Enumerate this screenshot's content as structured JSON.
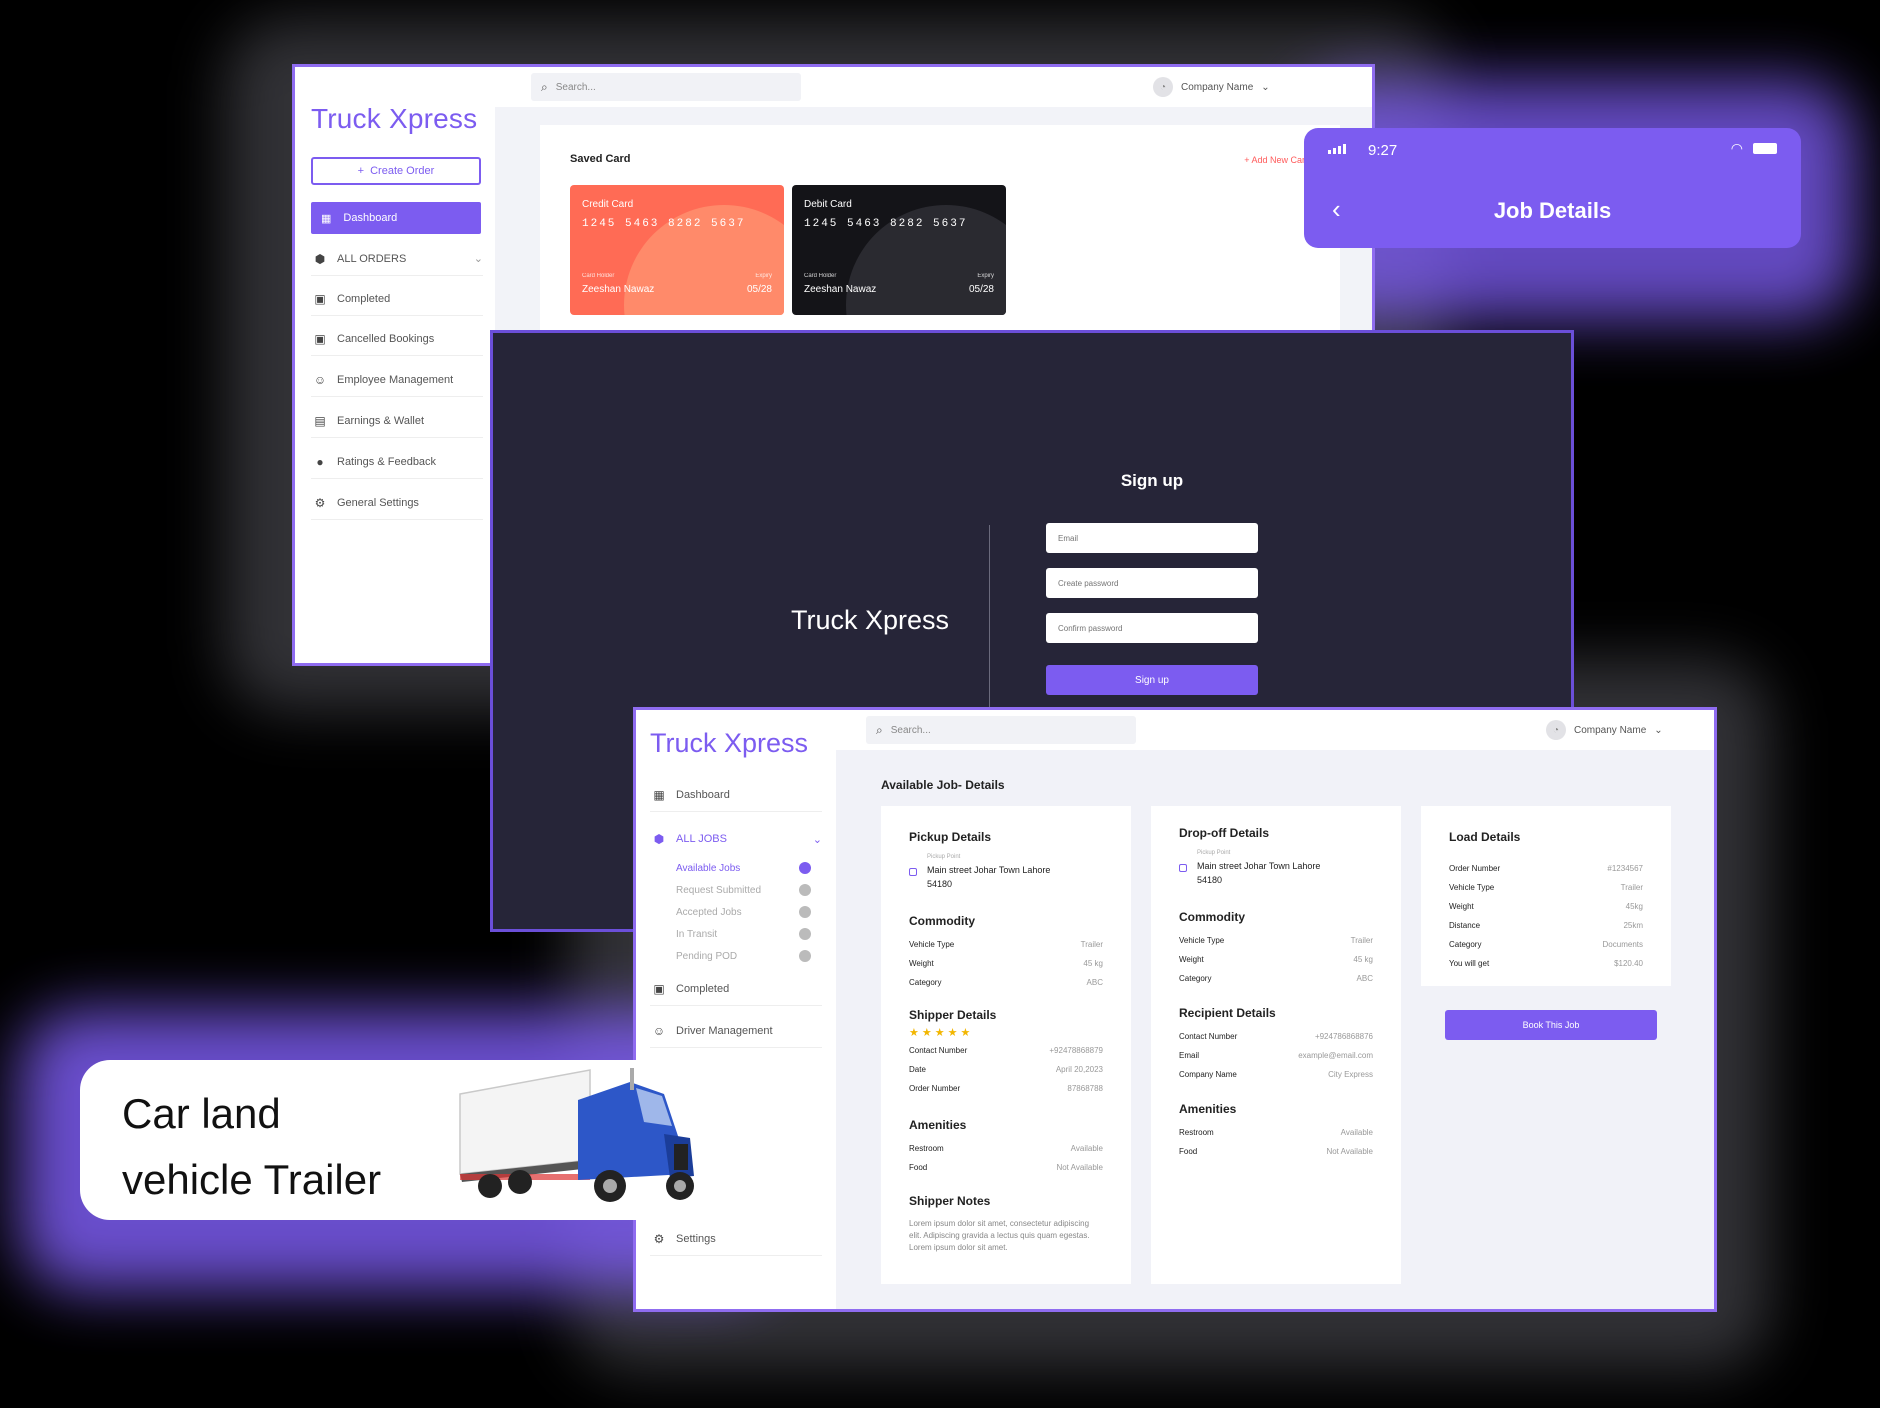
{
  "dashboard": {
    "logo": "Truck Xpress",
    "create_order": "Create Order",
    "nav_active": "Dashboard",
    "nav_items": [
      "ALL ORDERS",
      "Completed",
      "Cancelled Bookings",
      "Employee Management",
      "Earnings & Wallet",
      "Ratings & Feedback",
      "General Settings"
    ],
    "search_placeholder": "Search...",
    "company": "Company Name",
    "saved_card_title": "Saved Card",
    "add_new_card": "+ Add New Card",
    "cards": [
      {
        "type": "Credit Card",
        "number": "1245 5463 8282 5637",
        "holder_label": "Card Holder",
        "holder": "Zeeshan Nawaz",
        "expiry_label": "Expiry",
        "expiry": "05/28"
      },
      {
        "type": "Debit Card",
        "number": "1245 5463 8282 5637",
        "holder_label": "Card Holder",
        "holder": "Zeeshan Nawaz",
        "expiry_label": "Expiry",
        "expiry": "05/28"
      }
    ]
  },
  "mobile": {
    "time": "9:27",
    "title": "Job Details"
  },
  "signup": {
    "brand": "Truck Xpress",
    "title": "Sign up",
    "email_placeholder": "Email",
    "password_placeholder": "Create password",
    "confirm_placeholder": "Confirm password",
    "button": "Sign up"
  },
  "jobs": {
    "logo": "Truck Xpress",
    "search_placeholder": "Search...",
    "company": "Company Name",
    "nav": {
      "dashboard": "Dashboard",
      "all_jobs": "ALL JOBS",
      "sub": [
        "Available Jobs",
        "Request Submitted",
        "Accepted Jobs",
        "In Transit",
        "Pending POD"
      ],
      "completed": "Completed",
      "driver": "Driver Management",
      "settings": "Settings"
    },
    "page_title": "Available Job- Details",
    "pickup": {
      "title": "Pickup Details",
      "loc_label": "Pickup Point",
      "address": "Main street Johar Town Lahore 54180",
      "commodity_title": "Commodity",
      "commodity": [
        [
          "Vehicle Type",
          "Trailer"
        ],
        [
          "Weight",
          "45 kg"
        ],
        [
          "Category",
          "ABC"
        ]
      ],
      "shipper_title": "Shipper Details",
      "stars": "★★★★★",
      "shipper": [
        [
          "Contact Number",
          "+92478868879"
        ],
        [
          "Date",
          "April 20,2023"
        ],
        [
          "Order Number",
          "87868788"
        ]
      ],
      "amenities_title": "Amenities",
      "amenities": [
        [
          "Restroom",
          "Available"
        ],
        [
          "Food",
          "Not Available"
        ]
      ],
      "notes_title": "Shipper Notes",
      "notes": "Lorem ipsum dolor sit amet, consectetur adipiscing elit. Adipiscing gravida a lectus quis quam egestas. Lorem ipsum dolor sit amet."
    },
    "dropoff": {
      "title": "Drop-off Details",
      "loc_label": "Pickup Point",
      "address": "Main street Johar Town Lahore 54180",
      "commodity_title": "Commodity",
      "commodity": [
        [
          "Vehicle Type",
          "Trailer"
        ],
        [
          "Weight",
          "45 kg"
        ],
        [
          "Category",
          "ABC"
        ]
      ],
      "recipient_title": "Recipient Details",
      "recipient": [
        [
          "Contact Number",
          "+924786868876"
        ],
        [
          "Email",
          "example@email.com"
        ],
        [
          "Company Name",
          "City Express"
        ]
      ],
      "amenities_title": "Amenities",
      "amenities": [
        [
          "Restroom",
          "Available"
        ],
        [
          "Food",
          "Not Available"
        ]
      ]
    },
    "load": {
      "title": "Load Details",
      "rows": [
        [
          "Order Number",
          "#1234567"
        ],
        [
          "Vehicle Type",
          "Trailer"
        ],
        [
          "Weight",
          "45kg"
        ],
        [
          "Distance",
          "25km"
        ],
        [
          "Category",
          "Documents"
        ],
        [
          "You will get",
          "$120.40"
        ]
      ],
      "button": "Book This Job"
    }
  },
  "promo": {
    "line1": "Car land",
    "line2": "vehicle Trailer"
  },
  "colors": {
    "accent": "#7c5cf0",
    "dark": "#262538",
    "credit": "#ff6b55",
    "debit": "#141418"
  }
}
